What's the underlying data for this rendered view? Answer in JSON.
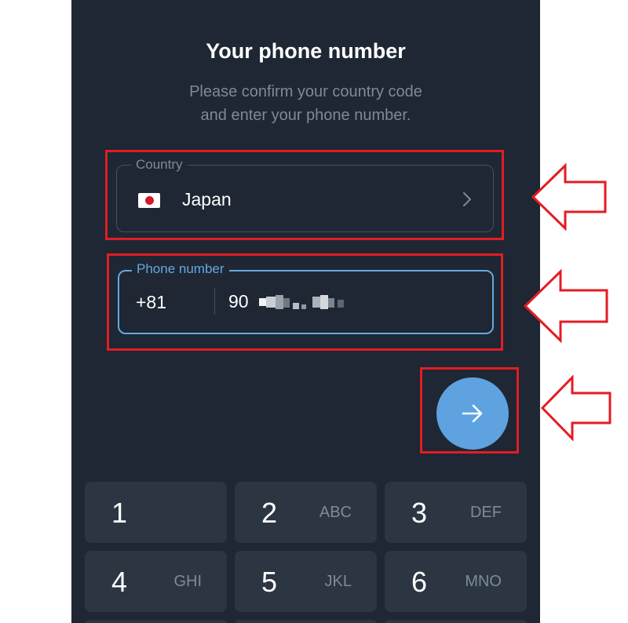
{
  "header": {
    "title": "Your phone number",
    "subtitle_line1": "Please confirm your country code",
    "subtitle_line2": "and enter your phone number."
  },
  "country": {
    "label": "Country",
    "flag_icon": "japan-flag-icon",
    "value": "Japan",
    "chevron_icon": "chevron-right-icon"
  },
  "phone": {
    "label": "Phone number",
    "code": "+81",
    "number": "90",
    "number_note": "remaining digits are pixelated / obscured"
  },
  "next_button": {
    "icon": "arrow-right-icon"
  },
  "keypad": {
    "keys": [
      {
        "digit": "1",
        "letters": ""
      },
      {
        "digit": "2",
        "letters": "ABC"
      },
      {
        "digit": "3",
        "letters": "DEF"
      },
      {
        "digit": "4",
        "letters": "GHI"
      },
      {
        "digit": "5",
        "letters": "JKL"
      },
      {
        "digit": "6",
        "letters": "MNO"
      }
    ]
  },
  "colors": {
    "background": "#1e2733",
    "accent": "#65a8e3",
    "fab": "#5ea2e0",
    "key": "#2c3642",
    "highlight": "#e31c23"
  }
}
